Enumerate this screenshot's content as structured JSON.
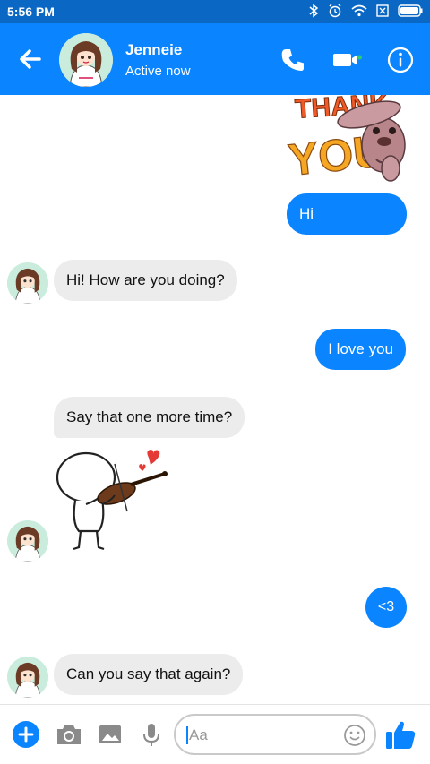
{
  "status_bar": {
    "time": "5:56 PM"
  },
  "header": {
    "name": "Jenneie",
    "status": "Active now"
  },
  "messages": [
    {
      "id": "m1",
      "text": "Hi"
    },
    {
      "id": "m2",
      "text": "Hi! How are you doing?"
    },
    {
      "id": "m3",
      "text": "I love you"
    },
    {
      "id": "m4",
      "text": "Say that one more time?"
    },
    {
      "id": "m5",
      "text": "<3"
    },
    {
      "id": "m6",
      "text": "Can you say that again?"
    }
  ],
  "stickers": {
    "thank_you": {
      "text_line1": "THANK",
      "text_line2": "YOU!"
    }
  },
  "composer": {
    "placeholder": "Aa"
  },
  "colors": {
    "accent": "#0a84ff",
    "status_bar": "#0a67c4",
    "incoming": "#ececec",
    "active_dot": "#2ecc71",
    "heart": "#e53935"
  },
  "icons": [
    "back-arrow-icon",
    "phone-icon",
    "video-camera-icon",
    "info-icon",
    "plus-icon",
    "camera-icon",
    "image-icon",
    "microphone-icon",
    "emoji-icon",
    "thumbs-up-icon"
  ]
}
